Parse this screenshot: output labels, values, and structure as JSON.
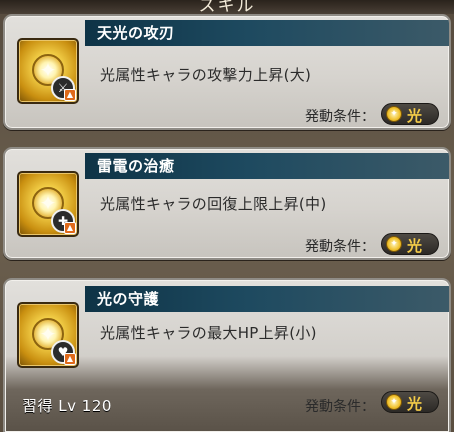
{
  "header": {
    "title": "スキル"
  },
  "skills": [
    {
      "name": "天光の攻刃",
      "description": "光属性キャラの攻撃力上昇(大)",
      "condition_label": "発動条件：",
      "condition_element": "光",
      "icon": "sword-up-icon"
    },
    {
      "name": "雷電の治癒",
      "description": "光属性キャラの回復上限上昇(中)",
      "condition_label": "発動条件：",
      "condition_element": "光",
      "icon": "heal-up-icon"
    },
    {
      "name": "光の守護",
      "description": "光属性キャラの最大HP上昇(小)",
      "condition_label": "発動条件：",
      "condition_element": "光",
      "icon": "heart-up-icon"
    }
  ],
  "learn_text": "習得 Lv 120",
  "colors": {
    "title_bar": "#0e3346",
    "element_light": "#f4cc48"
  }
}
